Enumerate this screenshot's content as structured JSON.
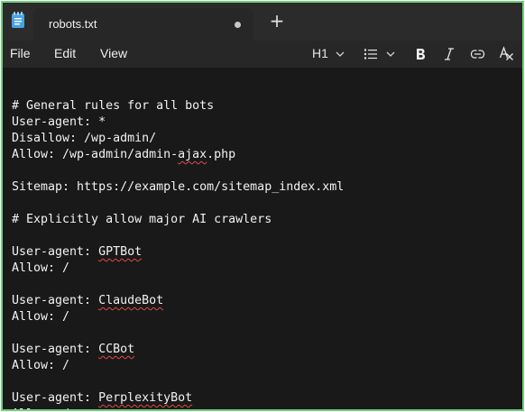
{
  "tab": {
    "title": "robots.txt"
  },
  "menu": {
    "file": "File",
    "edit": "Edit",
    "view": "View"
  },
  "toolbar": {
    "heading": "H1"
  },
  "editor": {
    "lines": [
      [],
      [
        {
          "t": "# General rules for all bots"
        }
      ],
      [
        {
          "t": "User-agent: *"
        }
      ],
      [
        {
          "t": "Disallow: /wp-admin/"
        }
      ],
      [
        {
          "t": "Allow: /wp-admin/admin-"
        },
        {
          "t": "ajax",
          "s": true
        },
        {
          "t": ".php"
        }
      ],
      [],
      [
        {
          "t": "Sitemap: https://example.com/sitemap_index.xml"
        }
      ],
      [],
      [
        {
          "t": "# Explicitly allow major AI crawlers"
        }
      ],
      [],
      [
        {
          "t": "User-agent: "
        },
        {
          "t": "GPTBot",
          "s": true
        }
      ],
      [
        {
          "t": "Allow: /"
        }
      ],
      [],
      [
        {
          "t": "User-agent: "
        },
        {
          "t": "ClaudeBot",
          "s": true
        }
      ],
      [
        {
          "t": "Allow: /"
        }
      ],
      [],
      [
        {
          "t": "User-agent: "
        },
        {
          "t": "CCBot",
          "s": true
        }
      ],
      [
        {
          "t": "Allow: /"
        }
      ],
      [],
      [
        {
          "t": "User-agent: "
        },
        {
          "t": "PerplexityBot",
          "s": true
        }
      ],
      [
        {
          "t": "Allow: /"
        }
      ]
    ]
  },
  "colors": {
    "frame_border": "#6fd17a",
    "spellcheck_underline": "#e04848",
    "app_icon": "#4aa3df"
  },
  "icons": [
    "notepad-icon",
    "close-tab-dot-icon",
    "plus-icon",
    "chevron-down-icon",
    "list-icon",
    "bold-icon",
    "italic-icon",
    "link-icon",
    "clear-formatting-icon"
  ]
}
